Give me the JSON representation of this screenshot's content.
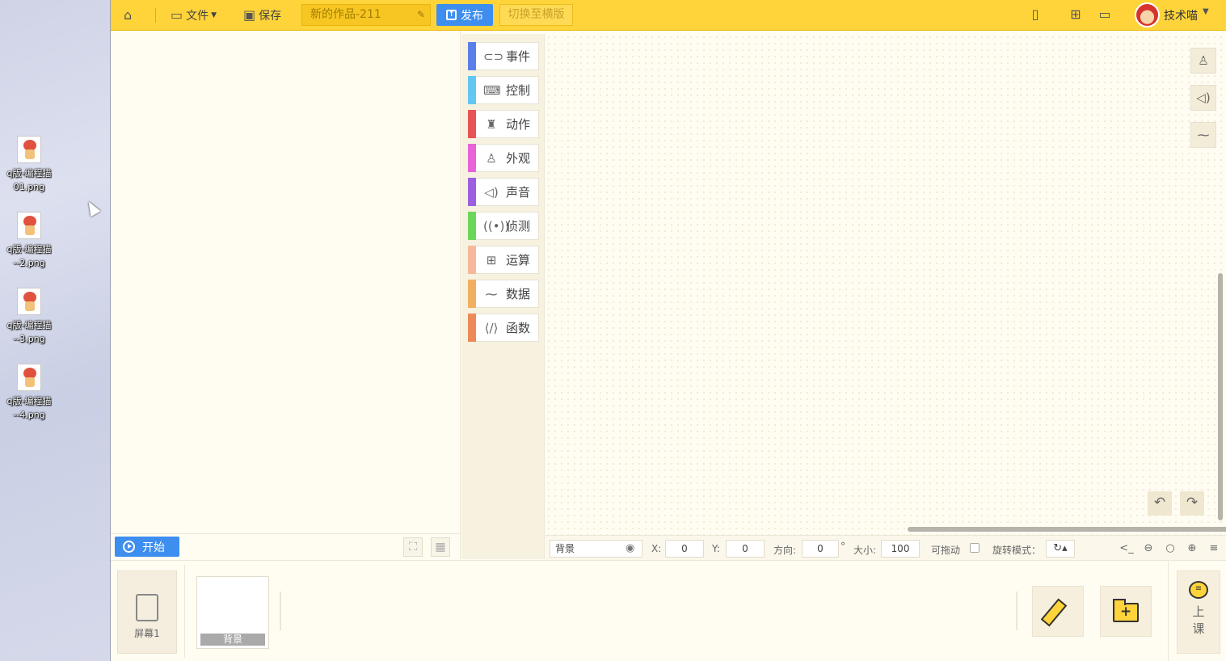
{
  "desktop": {
    "icons": [
      {
        "name_line1": "q版-编程猫",
        "name_line2": "01.png"
      },
      {
        "name_line1": "q版-编程猫",
        "name_line2": "--2.png"
      },
      {
        "name_line1": "q版-编程猫",
        "name_line2": "--3.png"
      },
      {
        "name_line1": "q版-编程猫",
        "name_line2": "--4.png"
      }
    ]
  },
  "topbar": {
    "file_label": "文件",
    "save_label": "保存",
    "project_title": "新的作品-211",
    "publish_label": "发布",
    "switch_label": "切换至横版",
    "username": "技术喵",
    "accent_color": "#ffd43a",
    "button_color": "#3e8ef0"
  },
  "categories": [
    {
      "label": "事件",
      "color": "#5b7fe8",
      "icon": "toggle-icon"
    },
    {
      "label": "控制",
      "color": "#63c7f2",
      "icon": "gamepad-icon"
    },
    {
      "label": "动作",
      "color": "#e85454",
      "icon": "running-icon"
    },
    {
      "label": "外观",
      "color": "#e863d8",
      "icon": "shirt-icon"
    },
    {
      "label": "声音",
      "color": "#9b5fe0",
      "icon": "speaker-icon"
    },
    {
      "label": "侦测",
      "color": "#6bd65a",
      "icon": "signal-icon"
    },
    {
      "label": "运算",
      "color": "#f5b89b",
      "icon": "calculator-icon"
    },
    {
      "label": "数据",
      "color": "#f0b060",
      "icon": "chart-line-icon"
    },
    {
      "label": "函数",
      "color": "#ec8a5a",
      "icon": "code-icon"
    }
  ],
  "stage": {
    "start_label": "开始"
  },
  "props": {
    "sprite_name": "背景",
    "x_label": "X:",
    "x_value": "0",
    "y_label": "Y:",
    "y_value": "0",
    "direction_label": "方向:",
    "direction_value": "0",
    "degree_symbol": "°",
    "size_label": "大小:",
    "size_value": "100",
    "draggable_label": "可拖动",
    "rotate_label": "旋转模式："
  },
  "assets": {
    "screen_label": "屏幕1",
    "background_label": "背景",
    "class_label_1": "上",
    "class_label_2": "课"
  }
}
